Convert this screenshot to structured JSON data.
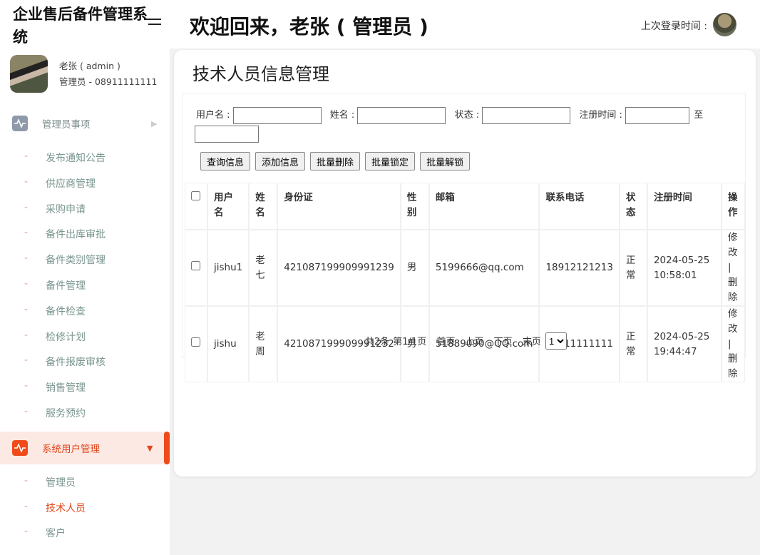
{
  "app": {
    "title": "企业售后备件管理系统",
    "welcome": "欢迎回来，老张 ( 管理员 )",
    "last_login_label": "上次登录时间 :"
  },
  "user": {
    "name": "老张 ( admin )",
    "role": "管理员 - 08911111111"
  },
  "sidebar": {
    "group1": {
      "label": "管理员事项",
      "items": [
        "发布通知公告",
        "供应商管理",
        "采购申请",
        "备件出库审批",
        "备件类别管理",
        "备件管理",
        "备件检查",
        "检修计划",
        "备件报废审核",
        "销售管理",
        "服务预约"
      ]
    },
    "group2": {
      "label": "系统用户管理",
      "items": [
        "管理员",
        "技术人员",
        "客户"
      ],
      "active": "技术人员"
    }
  },
  "page": {
    "title": "技术人员信息管理"
  },
  "filters": {
    "username": "用户名 :",
    "name": "姓名 :",
    "status": "状态 :",
    "regtime": "注册时间 :",
    "to": "至"
  },
  "buttons": [
    "查询信息",
    "添加信息",
    "批量删除",
    "批量锁定",
    "批量解锁"
  ],
  "table": {
    "headers": [
      "用户名",
      "姓名",
      "身份证",
      "性别",
      "邮箱",
      "联系电话",
      "状态",
      "注册时间",
      "操作"
    ],
    "rows": [
      {
        "username": "jishu1",
        "name": "老七",
        "id": "421087199909991239",
        "gender": "男",
        "email": "5199666@qq.com",
        "phone": "18912121213",
        "status": "正常",
        "date": "2024-05-25",
        "time": "10:58:01",
        "edit": "修改 |",
        "del": "删除"
      },
      {
        "username": "jishu",
        "name": "老周",
        "id": "421087199909991232",
        "gender": "男",
        "email": "51889090@QQ.com",
        "phone": "08911111111",
        "status": "正常",
        "date": "2024-05-25",
        "time": "19:44:47",
        "edit": "修改 |",
        "del": "删除"
      }
    ]
  },
  "pager": {
    "total": "共2条",
    "page": "第1/1页",
    "first": "首页",
    "prev": "上页",
    "next": "下页",
    "last": "末页",
    "current": "1"
  },
  "colors": {
    "accent": "#f04a1a",
    "active_bg": "#fde9e4"
  }
}
